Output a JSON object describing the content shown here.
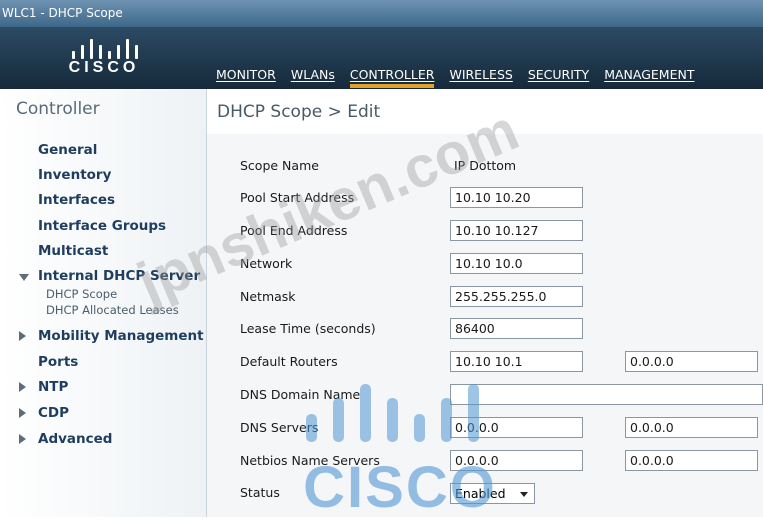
{
  "window": {
    "title": "WLC1 - DHCP Scope"
  },
  "brand": {
    "logo_text": "CISCO"
  },
  "nav": [
    {
      "label": "MONITOR"
    },
    {
      "label": "WLANs"
    },
    {
      "label": "CONTROLLER",
      "active": true
    },
    {
      "label": "WIRELESS"
    },
    {
      "label": "SECURITY"
    },
    {
      "label": "MANAGEMENT"
    }
  ],
  "sidebar": {
    "title": "Controller",
    "items": [
      {
        "label": "General"
      },
      {
        "label": "Inventory"
      },
      {
        "label": "Interfaces"
      },
      {
        "label": "Interface Groups"
      },
      {
        "label": "Multicast"
      },
      {
        "label": "Internal DHCP Server",
        "expanded": true,
        "icon": "triangle-down-icon"
      },
      {
        "label": "DHCP Scope"
      },
      {
        "label": "DHCP Allocated Leases"
      },
      {
        "label": "Mobility Management",
        "icon": "triangle-right-icon"
      },
      {
        "label": "Ports"
      },
      {
        "label": "NTP",
        "icon": "triangle-right-icon"
      },
      {
        "label": "CDP",
        "icon": "triangle-right-icon"
      },
      {
        "label": "Advanced",
        "icon": "triangle-right-icon"
      }
    ]
  },
  "page": {
    "title": "DHCP Scope > Edit"
  },
  "form": {
    "scope_name": {
      "label": "Scope Name",
      "value": "IP Dottom"
    },
    "pool_start": {
      "label": "Pool Start Address",
      "value": "10.10 10.20"
    },
    "pool_end": {
      "label": "Pool End Address",
      "value": "10.10 10.127"
    },
    "network": {
      "label": "Network",
      "value": "10.10 10.0"
    },
    "netmask": {
      "label": "Netmask",
      "value": "255.255.255.0"
    },
    "lease_time": {
      "label": "Lease Time (seconds)",
      "value": "86400"
    },
    "default_routers": {
      "label": "Default Routers",
      "value1": "10.10 10.1",
      "value2": "0.0.0.0"
    },
    "dns_domain": {
      "label": "DNS Domain Name",
      "value": ""
    },
    "dns_servers": {
      "label": "DNS Servers",
      "value1": "0.0.0.0",
      "value2": "0.0.0.0"
    },
    "netbios": {
      "label": "Netbios Name Servers",
      "value1": "0.0.0.0",
      "value2": "0.0.0.0"
    },
    "status": {
      "label": "Status",
      "value": "Enabled"
    }
  },
  "watermark": {
    "text": "jpnshiken.com",
    "logo_text": "CISCO"
  },
  "colors": {
    "header_bg": "#1e3447",
    "active_tab_underline": "#e2a02d",
    "sidebar_link": "#1f3d5f",
    "watermark_blue": "#5096d2"
  }
}
